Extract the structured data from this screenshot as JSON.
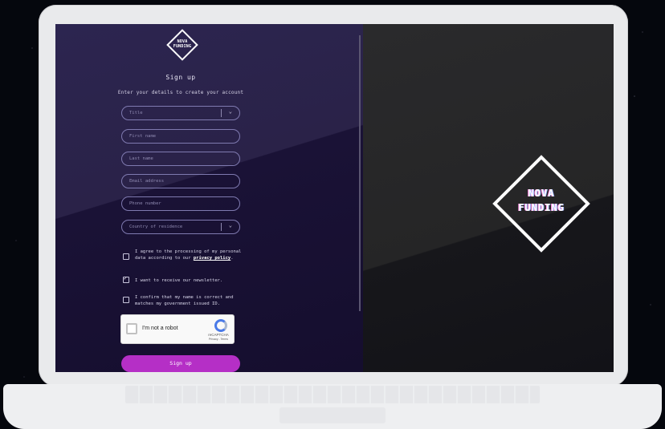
{
  "brand": {
    "line1": "NOVA",
    "line2": "FUNDING"
  },
  "form": {
    "heading": "Sign up",
    "subtitle": "Enter your details to create your account",
    "fields": {
      "title": "Title",
      "first_name": "First name",
      "last_name": "Last name",
      "email": "Email address",
      "phone": "Phone number",
      "country": "Country of residence"
    },
    "consents": {
      "privacy_pre": "I agree to the processing of my personal data according to our ",
      "privacy_link": "privacy policy",
      "privacy_post": ".",
      "newsletter": "I want to receive our newsletter.",
      "confirm": "I confirm that my name is correct and matches my government issued ID."
    },
    "newsletter_checked": true,
    "captcha": {
      "label": "I'm not a robot",
      "brand": "reCAPTCHA",
      "terms": "Privacy - Terms"
    },
    "submit": "Sign up"
  },
  "colors": {
    "accent": "#b52fc6",
    "panel": "#1a1236"
  }
}
